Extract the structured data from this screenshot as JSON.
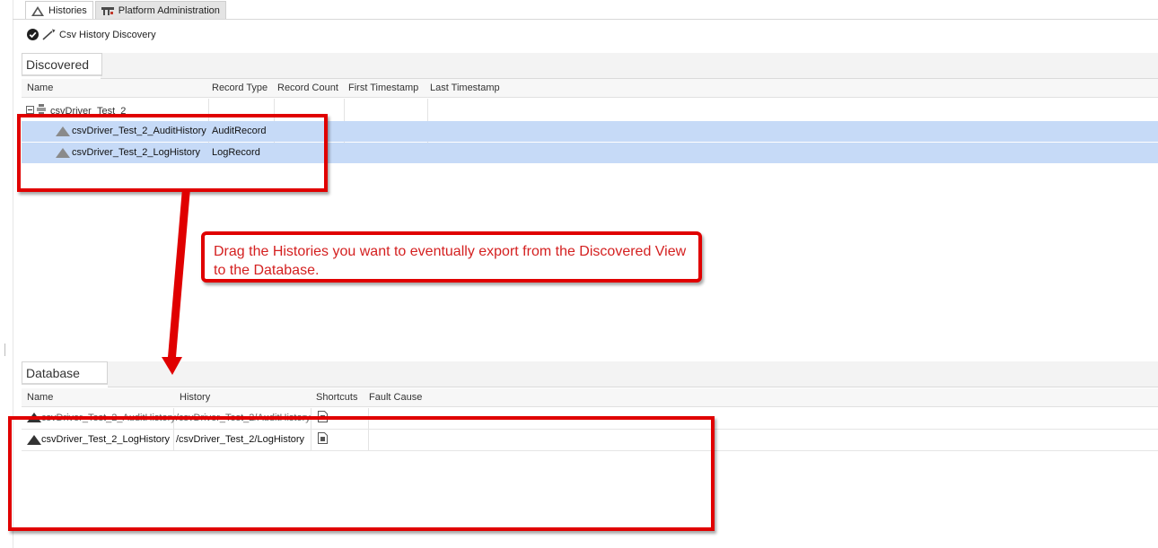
{
  "tabs": [
    {
      "label": "Histories",
      "icon": "history-icon",
      "active": true
    },
    {
      "label": "Platform Administration",
      "icon": "platform-admin-icon",
      "active": false
    }
  ],
  "view": {
    "title": "Csv History Discovery"
  },
  "discovered": {
    "label": "Discovered",
    "columns": [
      "Name",
      "Record Type",
      "Record Count",
      "First Timestamp",
      "Last Timestamp"
    ],
    "group": {
      "name": "csvDriver_Test_2"
    },
    "rows": [
      {
        "name": "csvDriver_Test_2_AuditHistory",
        "record_type": "AuditRecord",
        "record_count": "",
        "first_timestamp": "",
        "last_timestamp": ""
      },
      {
        "name": "csvDriver_Test_2_LogHistory",
        "record_type": "LogRecord",
        "record_count": "",
        "first_timestamp": "",
        "last_timestamp": ""
      }
    ]
  },
  "callout": {
    "line1": "Drag the Histories you want to eventually export from the Discovered View",
    "line2": "to the Database."
  },
  "database": {
    "label": "Database",
    "columns": [
      "Name",
      "History",
      "Shortcuts",
      "Fault Cause"
    ],
    "rows": [
      {
        "name": "csvDriver_Test_2_AuditHistory",
        "history": "/csvDriver_Test_2/AuditHistory"
      },
      {
        "name": "csvDriver_Test_2_LogHistory",
        "history": "/csvDriver_Test_2/LogHistory"
      }
    ]
  },
  "colors": {
    "selection": "#c6daf7",
    "annotation_red": "#e00000",
    "callout_text": "#d42020",
    "status_ok": "#2e8b2e"
  }
}
